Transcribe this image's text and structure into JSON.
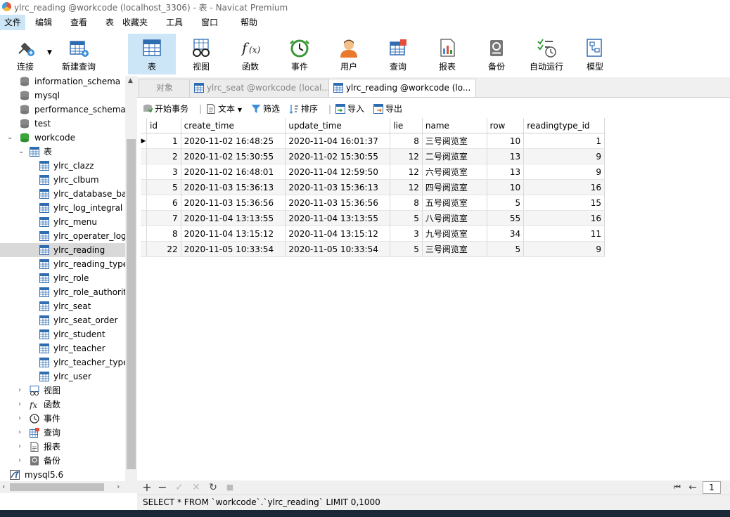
{
  "window": {
    "title": "ylrc_reading @workcode (localhost_3306) - 表 - Navicat Premium"
  },
  "menu": [
    "文件",
    "编辑",
    "查看",
    "表",
    "收藏夹",
    "工具",
    "窗口",
    "帮助"
  ],
  "toolbar": {
    "connect": "连接",
    "new_query": "新建查询",
    "buttons": [
      "表",
      "视图",
      "函数",
      "事件",
      "用户",
      "查询",
      "报表",
      "备份",
      "自动运行",
      "模型"
    ]
  },
  "sidebar": {
    "databases": [
      "information_schema",
      "mysql",
      "performance_schema",
      "test",
      "workcode"
    ],
    "tables_group": "表",
    "tables": [
      "ylrc_clazz",
      "ylrc_clbum",
      "ylrc_database_bal",
      "ylrc_log_integral",
      "ylrc_menu",
      "ylrc_operater_log",
      "ylrc_reading",
      "ylrc_reading_type",
      "ylrc_role",
      "ylrc_role_authoriti",
      "ylrc_seat",
      "ylrc_seat_order",
      "ylrc_student",
      "ylrc_teacher",
      "ylrc_teacher_type",
      "ylrc_user"
    ],
    "selected_table": "ylrc_reading",
    "groups": [
      "视图",
      "函数",
      "事件",
      "查询",
      "报表",
      "备份"
    ],
    "connection2": "mysql5.6"
  },
  "tabs": [
    "对象",
    "ylrc_seat @workcode (local...",
    "ylrc_reading @workcode (lo..."
  ],
  "object_toolbar": {
    "begin_transaction": "开始事务",
    "text": "文本",
    "filter": "筛选",
    "sort": "排序",
    "import": "导入",
    "export": "导出"
  },
  "grid": {
    "columns": [
      "id",
      "create_time",
      "update_time",
      "lie",
      "name",
      "row",
      "readingtype_id"
    ],
    "rows": [
      [
        "1",
        "2020-11-02 16:48:25",
        "2020-11-04 16:01:37",
        "8",
        "三号阅览室",
        "10",
        "1"
      ],
      [
        "2",
        "2020-11-02 15:30:55",
        "2020-11-02 15:30:55",
        "12",
        "二号阅览室",
        "13",
        "9"
      ],
      [
        "3",
        "2020-11-02 16:48:01",
        "2020-11-04 12:59:50",
        "12",
        "六号阅览室",
        "13",
        "9"
      ],
      [
        "5",
        "2020-11-03 15:36:13",
        "2020-11-03 15:36:13",
        "12",
        "四号阅览室",
        "10",
        "16"
      ],
      [
        "6",
        "2020-11-03 15:36:56",
        "2020-11-03 15:36:56",
        "8",
        "五号阅览室",
        "5",
        "15"
      ],
      [
        "7",
        "2020-11-04 13:13:55",
        "2020-11-04 13:13:55",
        "5",
        "八号阅览室",
        "55",
        "16"
      ],
      [
        "8",
        "2020-11-04 13:15:12",
        "2020-11-04 13:15:12",
        "3",
        "九号阅览室",
        "34",
        "11"
      ],
      [
        "22",
        "2020-11-05 10:33:54",
        "2020-11-05 10:33:54",
        "5",
        "三号阅览室",
        "5",
        "9"
      ]
    ]
  },
  "navigation": {
    "page": "1"
  },
  "status": {
    "sql": "SELECT * FROM `workcode`.`ylrc_reading` LIMIT 0,1000"
  }
}
